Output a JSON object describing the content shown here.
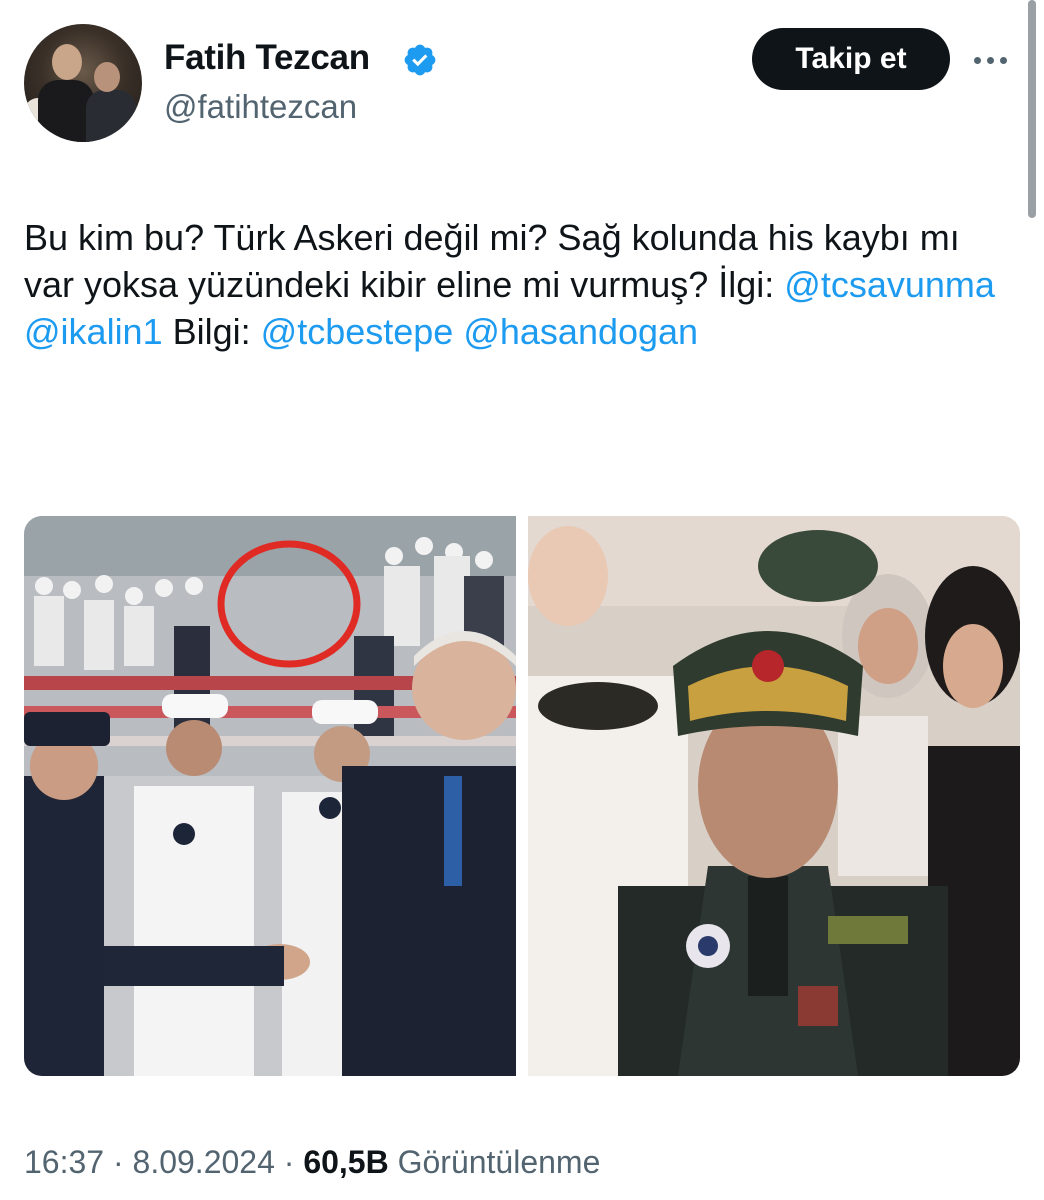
{
  "author": {
    "name": "Fatih Tezcan",
    "handle": "@fatihtezcan",
    "verified": true,
    "verified_color": "#1d9bf0"
  },
  "actions": {
    "follow_label": "Takip et",
    "more_icon": "more-horizontal-icon"
  },
  "tweet": {
    "text_1": "Bu kim bu? Türk Askeri değil mi? Sağ kolunda his kaybı mı var yoksa yüzündeki kibir eline mi vurmuş? İlgi: ",
    "mention_1": "@tcsavunma",
    "mention_2": "@ikalin1",
    "text_2": " Bilgi: ",
    "mention_3": "@tcbestepe",
    "mention_4": "@hasandogan",
    "mention_color": "#1d9bf0"
  },
  "media": {
    "count": 2,
    "left_image": "ceremony-photo-with-red-circle",
    "right_image": "zoomed-officer-photo"
  },
  "meta": {
    "time": "16:37",
    "sep": " · ",
    "date": "8.09.2024",
    "views_count": "60,5B",
    "views_label": " Görüntülenme"
  }
}
